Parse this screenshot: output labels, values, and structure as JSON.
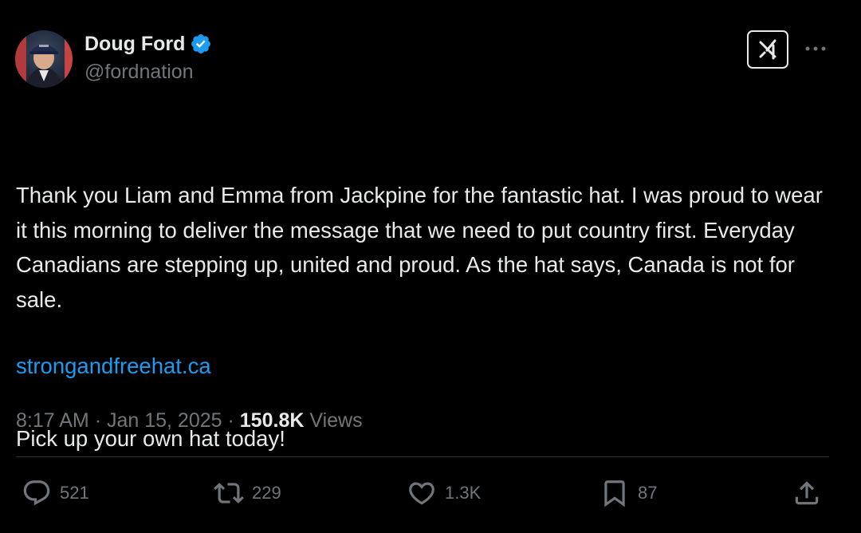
{
  "author": {
    "name": "Doug Ford",
    "handle": "@fordnation",
    "verified": true,
    "avatar_icon": "avatar-photo"
  },
  "tweet": {
    "paragraphs": [
      "Thank you Liam and Emma from Jackpine for the fantastic hat. I was proud to wear it this morning to deliver the message that we need to put country first. Everyday Canadians are stepping up, united and proud. As the hat says, Canada is not for sale.",
      "Pick up your own hat today!"
    ],
    "link": "strongandfreehat.ca",
    "time": "8:17 AM",
    "date": "Jan 15, 2025",
    "views_count": "150.8K",
    "views_label": "Views",
    "separator": "·"
  },
  "actions": {
    "reply": "521",
    "repost": "229",
    "like": "1.3K",
    "bookmark": "87"
  },
  "colors": {
    "background": "#000000",
    "text": "#e7e9ea",
    "secondary": "#71767b",
    "link": "#1d9bf0",
    "verified": "#1d9bf0",
    "divider": "#2f3336"
  },
  "icons": {
    "verified": "verified-badge-icon",
    "grok": "grok-icon",
    "more": "more-dots-icon",
    "reply": "reply-icon",
    "repost": "repost-icon",
    "like": "heart-icon",
    "bookmark": "bookmark-icon",
    "share": "share-icon"
  }
}
